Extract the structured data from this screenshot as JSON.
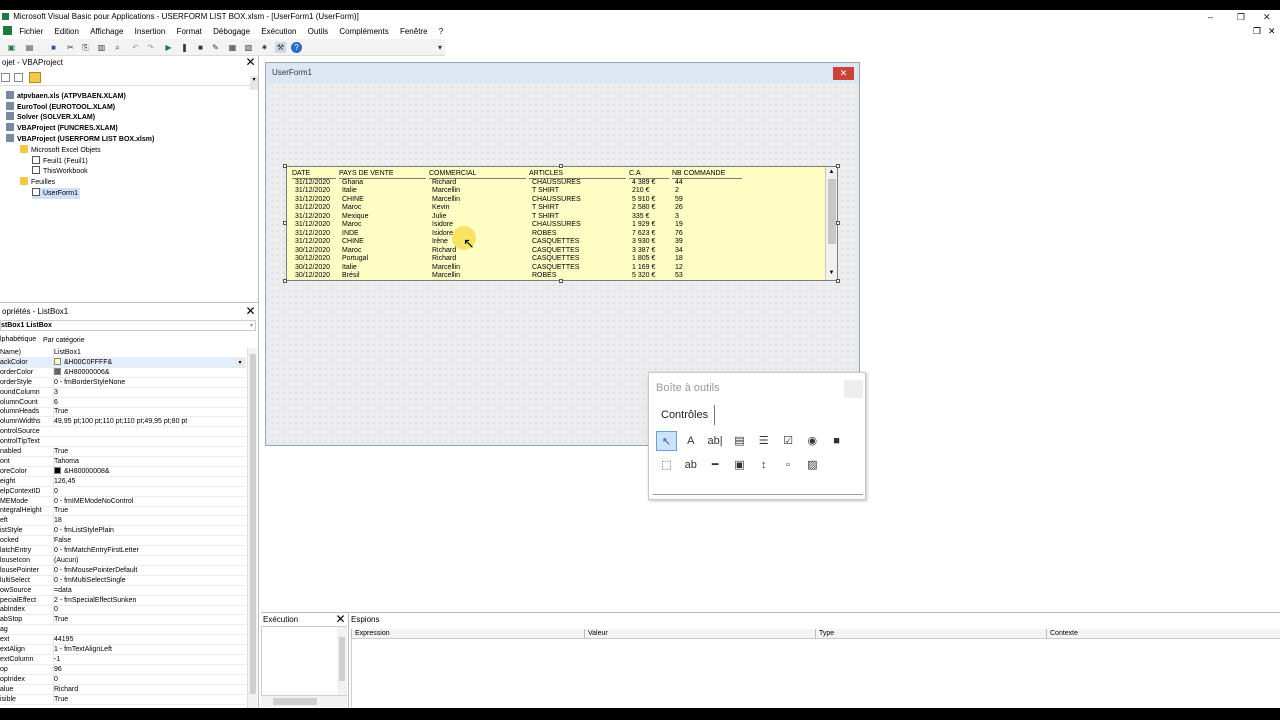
{
  "window": {
    "title": "Microsoft Visual Basic pour Applications - USERFORM LIST BOX.xlsm - [UserForm1 (UserForm)]",
    "minimize": "–",
    "restore": "❐",
    "close": "✕"
  },
  "menu": [
    "Fichier",
    "Edition",
    "Affichage",
    "Insertion",
    "Format",
    "Débogage",
    "Exécution",
    "Outils",
    "Compléments",
    "Fenêtre",
    "?"
  ],
  "project": {
    "title": "ojet - VBAProject",
    "close": "✕",
    "items": [
      {
        "label": "atpvbaen.xls (ATPVBAEN.XLAM)",
        "bold": true
      },
      {
        "label": "EuroTool (EUROTOOL.XLAM)",
        "bold": true
      },
      {
        "label": "Solver (SOLVER.XLAM)",
        "bold": true
      },
      {
        "label": "VBAProject (FUNCRES.XLAM)",
        "bold": true
      },
      {
        "label": "VBAProject (USERFORM LIST BOX.xlsm)",
        "bold": true
      },
      {
        "label": "Microsoft Excel Objets",
        "bold": false
      },
      {
        "label": "Feuil1 (Feuil1)",
        "bold": false
      },
      {
        "label": "ThisWorkbook",
        "bold": false
      },
      {
        "label": "Feuilles",
        "bold": false
      },
      {
        "label": "UserForm1",
        "bold": false
      }
    ]
  },
  "properties": {
    "title": "opriétés - ListBox1",
    "close": "✕",
    "object": "stBox1 ListBox",
    "tab_alpha": "lphabétique",
    "tab_cat": "Par catégorie",
    "rows": [
      {
        "name": "Name)",
        "value": "ListBox1"
      },
      {
        "name": "ackColor",
        "value": "&H00C0FFFF&"
      },
      {
        "name": "orderColor",
        "value": "&H80000006&"
      },
      {
        "name": "orderStyle",
        "value": "0 - fmBorderStyleNone"
      },
      {
        "name": "oundColumn",
        "value": "3"
      },
      {
        "name": "olumnCount",
        "value": "6"
      },
      {
        "name": "olumnHeads",
        "value": "True"
      },
      {
        "name": "olumnWidths",
        "value": "49,95 pt;100 pt;110 pt;110 pt;49,95 pt;80 pt"
      },
      {
        "name": "ontrolSource",
        "value": ""
      },
      {
        "name": "ontrolTipText",
        "value": ""
      },
      {
        "name": "nabled",
        "value": "True"
      },
      {
        "name": "ont",
        "value": "Tahoma"
      },
      {
        "name": "oreColor",
        "value": "&H80000008&"
      },
      {
        "name": "eight",
        "value": "126,45"
      },
      {
        "name": "elpContextID",
        "value": "0"
      },
      {
        "name": "MEMode",
        "value": "0 - fmIMEModeNoControl"
      },
      {
        "name": "ntegralHeight",
        "value": "True"
      },
      {
        "name": "eft",
        "value": "18"
      },
      {
        "name": "istStyle",
        "value": "0 - fmListStylePlain"
      },
      {
        "name": "ocked",
        "value": "False"
      },
      {
        "name": "latchEntry",
        "value": "0 - fmMatchEntryFirstLetter"
      },
      {
        "name": "louseIcon",
        "value": "(Aucun)"
      },
      {
        "name": "lousePointer",
        "value": "0 - fmMousePointerDefault"
      },
      {
        "name": "lultiSelect",
        "value": "0 - fmMultiSelectSingle"
      },
      {
        "name": "owSource",
        "value": "=data"
      },
      {
        "name": "pecialEffect",
        "value": "2 - fmSpecialEffectSunken"
      },
      {
        "name": "abIndex",
        "value": "0"
      },
      {
        "name": "abStop",
        "value": "True"
      },
      {
        "name": "ag",
        "value": ""
      },
      {
        "name": "ext",
        "value": "44195"
      },
      {
        "name": "extAlign",
        "value": "1 - fmTextAlignLeft"
      },
      {
        "name": "extColumn",
        "value": "-1"
      },
      {
        "name": "op",
        "value": "96"
      },
      {
        "name": "opIndex",
        "value": "0"
      },
      {
        "name": "alue",
        "value": "Richard"
      },
      {
        "name": "isible",
        "value": "True"
      }
    ],
    "colors": {
      "backcolor": "#ffffc0",
      "bordercolor": "#646464",
      "forecolor": "#000000"
    }
  },
  "userform": {
    "title": "UserForm1",
    "close": "✕",
    "listbox": {
      "headers": [
        "DATE",
        "PAYS DE VENTE",
        "COMMERCIAL",
        "ARTICLES",
        "C.A",
        "NB COMMANDE"
      ],
      "rows": [
        [
          "31/12/2020",
          "Ghana",
          "Richard",
          "CHAUSSURES",
          "4 389 €",
          "44"
        ],
        [
          "31/12/2020",
          "Italie",
          "Marcellin",
          "T SHIRT",
          "210 €",
          "2"
        ],
        [
          "31/12/2020",
          "CHINE",
          "Marcellin",
          "CHAUSSURES",
          "5 910 €",
          "59"
        ],
        [
          "31/12/2020",
          "Maroc",
          "Kevin",
          "T SHIRT",
          "2 580 €",
          "26"
        ],
        [
          "31/12/2020",
          "Mexique",
          "Julie",
          "T SHIRT",
          "335 €",
          "3"
        ],
        [
          "31/12/2020",
          "Maroc",
          "Isidore",
          "CHAUSSURES",
          "1 929 €",
          "19"
        ],
        [
          "31/12/2020",
          "INDE",
          "Isidore",
          "ROBES",
          "7 623 €",
          "76"
        ],
        [
          "31/12/2020",
          "CHINE",
          "Irène",
          "CASQUETTES",
          "3 930 €",
          "39"
        ],
        [
          "30/12/2020",
          "Maroc",
          "Richard",
          "CASQUETTES",
          "3 387 €",
          "34"
        ],
        [
          "30/12/2020",
          "Portugal",
          "Richard",
          "CASQUETTES",
          "1 805 €",
          "18"
        ],
        [
          "30/12/2020",
          "Italie",
          "Marcellin",
          "CASQUETTES",
          "1 169 €",
          "12"
        ],
        [
          "30/12/2020",
          "Brésil",
          "Marcellin",
          "ROBES",
          "5 320 €",
          "53"
        ]
      ],
      "background": "#fdfdc4"
    }
  },
  "toolbox": {
    "title": "Boîte à outils",
    "tab": "Contrôles",
    "tools_row1": [
      {
        "name": "pointer-icon",
        "glyph": "↖"
      },
      {
        "name": "label-icon",
        "glyph": "A"
      },
      {
        "name": "textbox-icon",
        "glyph": "ab|"
      },
      {
        "name": "combobox-icon",
        "glyph": "▤"
      },
      {
        "name": "listbox-icon",
        "glyph": "☰"
      },
      {
        "name": "checkbox-icon",
        "glyph": "☑"
      },
      {
        "name": "optionbutton-icon",
        "glyph": "◉"
      },
      {
        "name": "togglebutton-icon",
        "glyph": "■"
      }
    ],
    "tools_row2": [
      {
        "name": "frame-icon",
        "glyph": "⬚"
      },
      {
        "name": "commandbutton-icon",
        "glyph": "ab"
      },
      {
        "name": "tabstrip-icon",
        "glyph": "━"
      },
      {
        "name": "multipage-icon",
        "glyph": "▣"
      },
      {
        "name": "scrollbar-icon",
        "glyph": "↕"
      },
      {
        "name": "spinbutton-icon",
        "glyph": "▫"
      },
      {
        "name": "image-icon",
        "glyph": "▨"
      }
    ]
  },
  "execution": {
    "title": "Exécution",
    "close": "✕"
  },
  "watches": {
    "title": "Espions",
    "columns": [
      "Expression",
      "Valeur",
      "Type",
      "Contexte"
    ]
  }
}
